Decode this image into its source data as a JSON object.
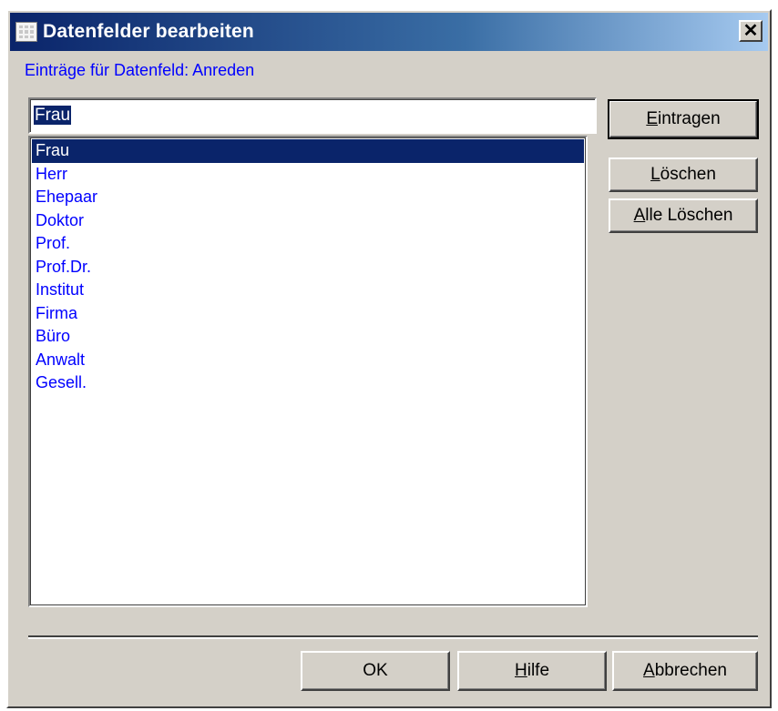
{
  "window": {
    "title": "Datenfelder bearbeiten",
    "close_glyph": "✕"
  },
  "field_label": "Einträge für Datenfeld: Anreden",
  "entry_input": {
    "value": "Frau"
  },
  "list": {
    "selected_index": 0,
    "items": [
      "Frau",
      "Herr",
      "Ehepaar",
      "Doktor",
      "Prof.",
      "Prof.Dr.",
      "Institut",
      "Firma",
      "Büro",
      "Anwalt",
      "Gesell."
    ]
  },
  "buttons": {
    "eintragen": {
      "mnemonic": "E",
      "rest": "intragen"
    },
    "loeschen": {
      "mnemonic": "L",
      "rest": "öschen"
    },
    "alle_loeschen": {
      "mnemonic": "A",
      "rest": "lle Löschen"
    },
    "ok": {
      "label": "OK"
    },
    "hilfe": {
      "mnemonic": "H",
      "rest": "ilfe"
    },
    "abbrechen": {
      "mnemonic": "A",
      "rest": "bbrechen"
    }
  },
  "colors": {
    "title_bar": "#0a246a",
    "dialog_face": "#d4d0c8",
    "label_text": "#0000ff",
    "selection": "#0a246a"
  }
}
